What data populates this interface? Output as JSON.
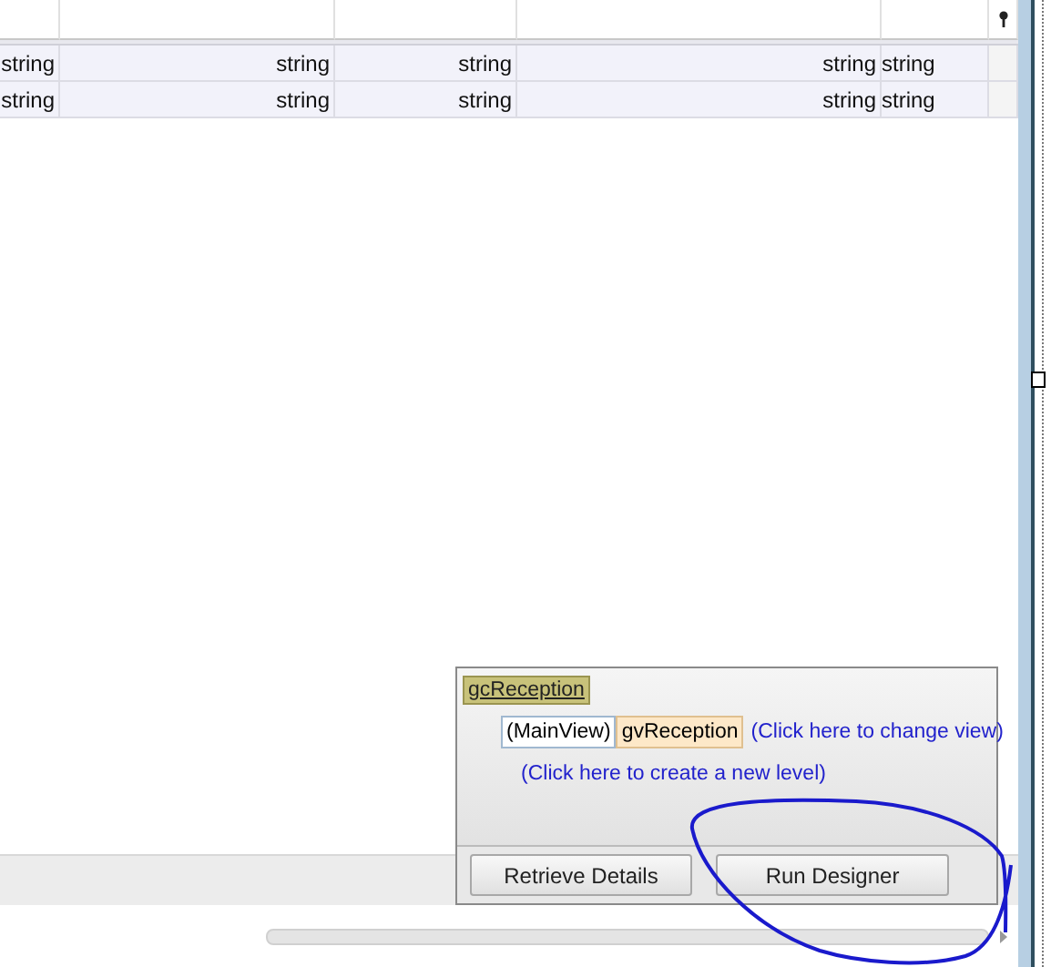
{
  "grid": {
    "rows": [
      [
        "string",
        "string",
        "string",
        "string",
        "string"
      ],
      [
        "string",
        "string",
        "string",
        "string",
        "string"
      ]
    ]
  },
  "designer": {
    "grid_control": "gcReception",
    "main_view": "(MainView)",
    "view_name": "gvReception",
    "change_view_link": "(Click here to change view)",
    "new_level_link": "(Click here to create a new level)",
    "buttons": [
      "Retrieve Details",
      "Run Designer"
    ]
  }
}
